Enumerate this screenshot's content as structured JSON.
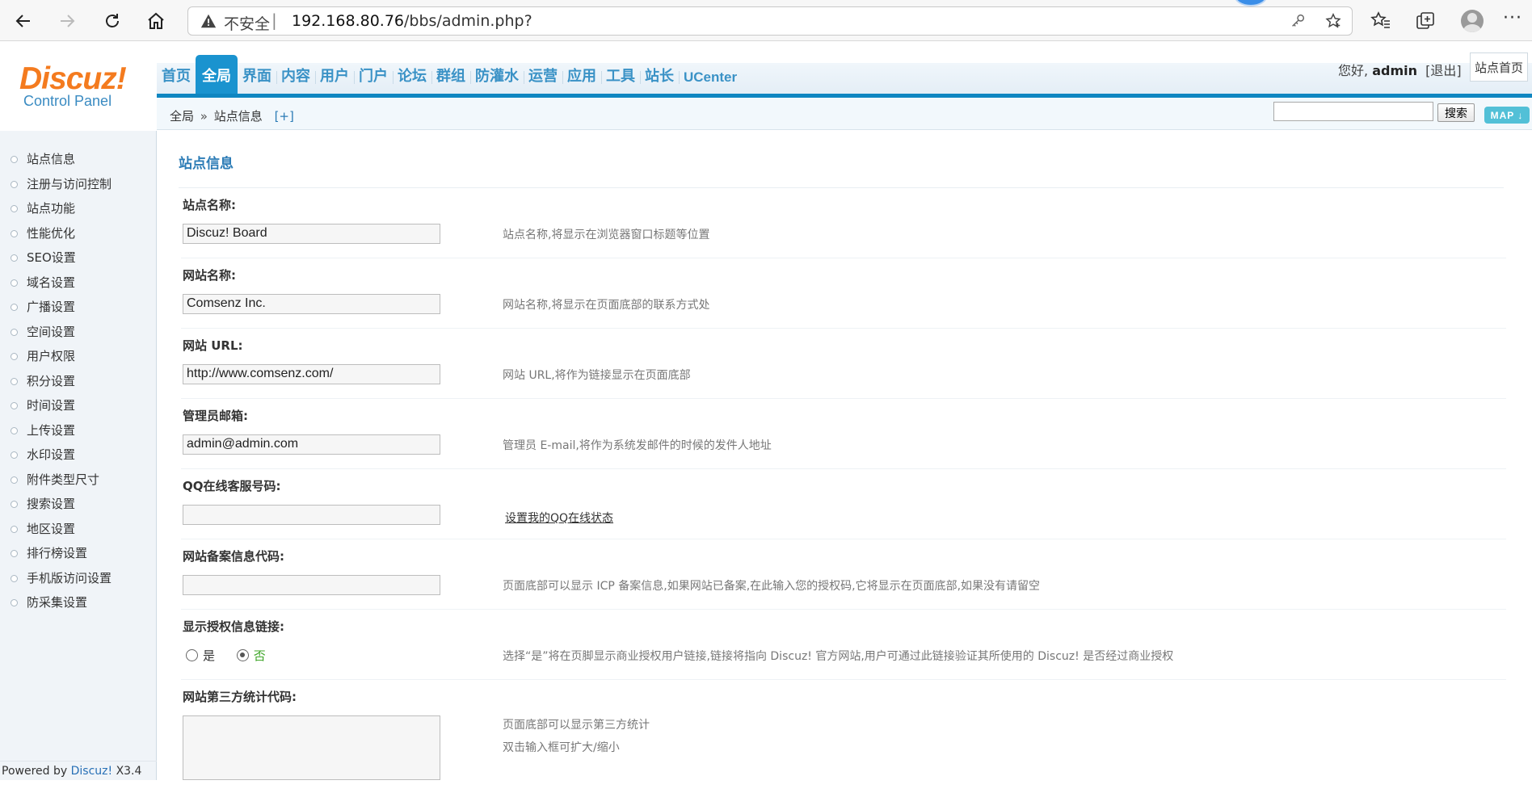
{
  "browser": {
    "security_label": "不安全",
    "separator": "|",
    "url_host": "192.168.80.76",
    "url_path": "/bbs/admin.php?"
  },
  "header": {
    "logo_main": "Discuz!",
    "logo_sub": "Control Panel",
    "nav": [
      {
        "label": "首页",
        "active": false
      },
      {
        "label": "全局",
        "active": true
      },
      {
        "label": "界面",
        "active": false
      },
      {
        "label": "内容",
        "active": false
      },
      {
        "label": "用户",
        "active": false
      },
      {
        "label": "门户",
        "active": false
      },
      {
        "label": "论坛",
        "active": false
      },
      {
        "label": "群组",
        "active": false
      },
      {
        "label": "防灌水",
        "active": false
      },
      {
        "label": "运营",
        "active": false
      },
      {
        "label": "应用",
        "active": false
      },
      {
        "label": "工具",
        "active": false
      },
      {
        "label": "站长",
        "active": false
      },
      {
        "label": "UCenter",
        "active": false
      }
    ],
    "greeting_prefix": "您好,",
    "username": "admin",
    "logout_label": "[退出]",
    "site_home_label": "站点首页"
  },
  "subbar": {
    "crumb_root": "全局",
    "crumb_arrow": "»",
    "crumb_current": "站点信息",
    "crumb_plus": "[+]",
    "search_value": "",
    "search_button": "搜索",
    "map_button": "MAP ↓"
  },
  "sidebar": {
    "items": [
      "站点信息",
      "注册与访问控制",
      "站点功能",
      "性能优化",
      "SEO设置",
      "域名设置",
      "广播设置",
      "空间设置",
      "用户权限",
      "积分设置",
      "时间设置",
      "上传设置",
      "水印设置",
      "附件类型尺寸",
      "搜索设置",
      "地区设置",
      "排行榜设置",
      "手机版访问设置",
      "防采集设置"
    ],
    "powered_prefix": "Powered by",
    "powered_brand": "Discuz!",
    "powered_version": "X3.4"
  },
  "main": {
    "section_title": "站点信息",
    "settings": {
      "site_name": {
        "label": "站点名称:",
        "value": "Discuz! Board",
        "hint": "站点名称,将显示在浏览器窗口标题等位置"
      },
      "web_name": {
        "label": "网站名称:",
        "value": "Comsenz Inc.",
        "hint": "网站名称,将显示在页面底部的联系方式处"
      },
      "web_url": {
        "label": "网站 URL:",
        "value": "http://www.comsenz.com/",
        "hint": "网站 URL,将作为链接显示在页面底部"
      },
      "admin_email": {
        "label": "管理员邮箱:",
        "value": "admin@admin.com",
        "hint": "管理员 E-mail,将作为系统发邮件的时候的发件人地址"
      },
      "qq_service": {
        "label": "QQ在线客服号码:",
        "value": "",
        "link": "设置我的QQ在线状态"
      },
      "icp": {
        "label": "网站备案信息代码:",
        "value": "",
        "hint": "页面底部可以显示 ICP 备案信息,如果网站已备案,在此输入您的授权码,它将显示在页面底部,如果没有请留空"
      },
      "license_link": {
        "label": "显示授权信息链接:",
        "yes": "是",
        "no": "否",
        "selected": "否",
        "hint": "选择“是”将在页脚显示商业授权用户链接,链接将指向 Discuz! 官方网站,用户可通过此链接验证其所使用的 Discuz! 是否经过商业授权"
      },
      "stat_code": {
        "label": "网站第三方统计代码:",
        "value": "",
        "hint_line1": "页面底部可以显示第三方统计",
        "hint_line2": "双击输入框可扩大/缩小"
      }
    }
  }
}
